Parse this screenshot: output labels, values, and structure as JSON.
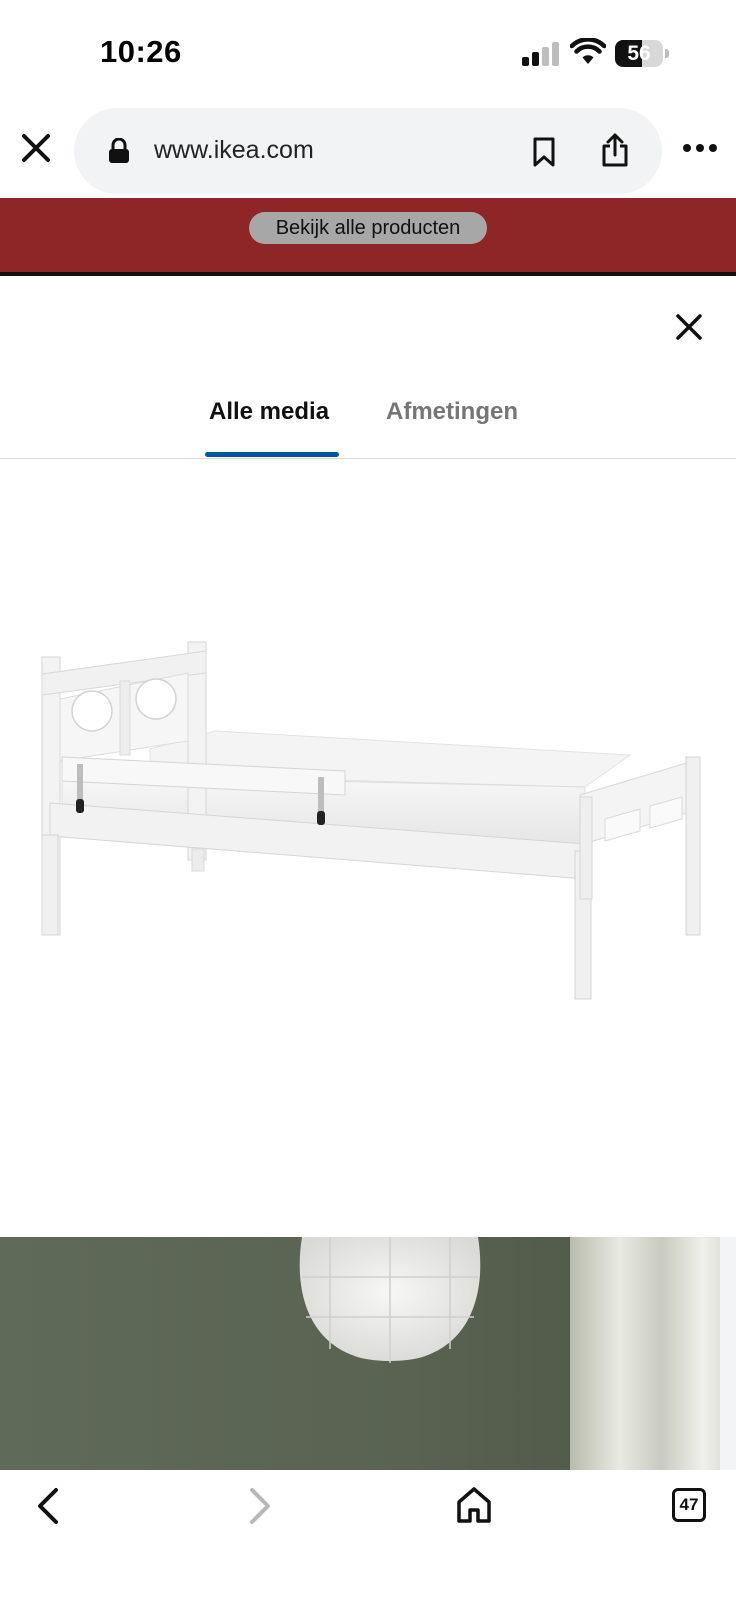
{
  "status_bar": {
    "time": "10:26",
    "battery": "56",
    "battery_level": 0.56
  },
  "browser": {
    "url": "www.ikea.com"
  },
  "promo": {
    "label": "Bekijk alle producten",
    "color": "#8e2628"
  },
  "modal": {
    "tabs": [
      {
        "label": "Alle media",
        "active": true
      },
      {
        "label": "Afmetingen",
        "active": false
      }
    ],
    "accent_color": "#0058a3"
  },
  "toolbar": {
    "tab_count": "47"
  },
  "icons": [
    "close-icon",
    "lock-icon",
    "bookmark-icon",
    "share-icon",
    "more-icon",
    "back-icon",
    "forward-icon",
    "home-icon",
    "tabs-icon"
  ]
}
